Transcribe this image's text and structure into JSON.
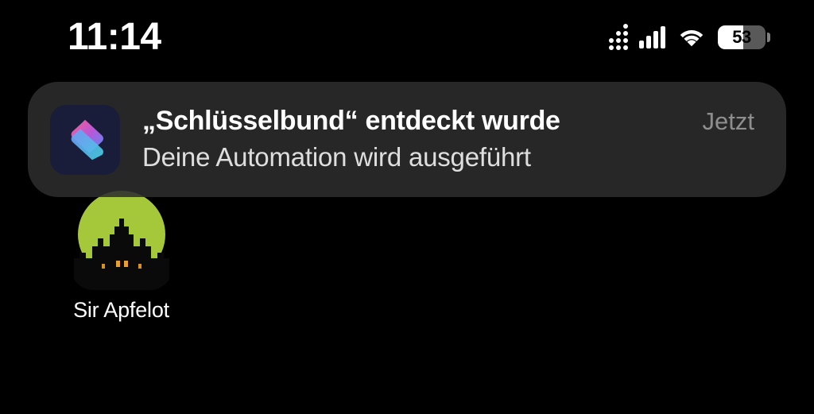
{
  "statusBar": {
    "time": "11:14",
    "battery": {
      "percent": "53"
    }
  },
  "notification": {
    "title": "„Schlüsselbund“ entdeckt wurde",
    "subtitle": "Deine Automation wird ausgeführt",
    "time": "Jetzt",
    "appIcon": "shortcuts-icon"
  },
  "homeScreen": {
    "apps": [
      {
        "label": "Sir Apfelot",
        "icon": "sir-apfelot-icon"
      }
    ]
  }
}
